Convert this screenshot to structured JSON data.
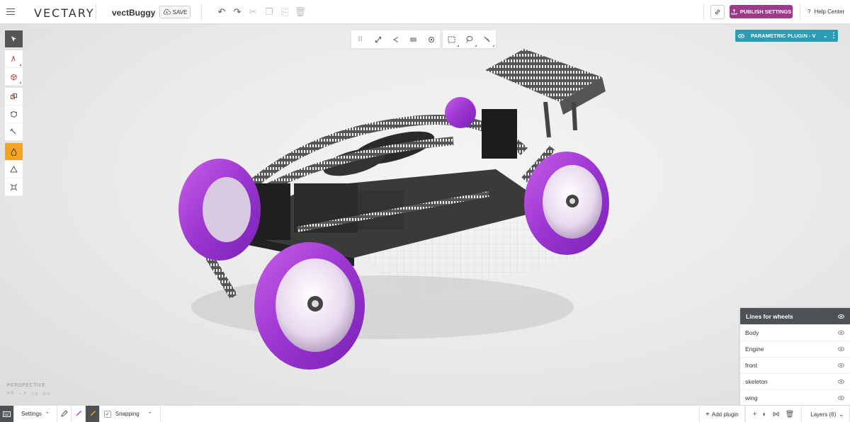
{
  "app": {
    "logo": "VECTARY",
    "project_name": "vectBuggy"
  },
  "toolbar": {
    "save_label": "SAVE"
  },
  "publish": {
    "label": "PUBLISH SETTINGS",
    "color": "#9e3a8a"
  },
  "help": {
    "label": "Help Center",
    "icon": "?"
  },
  "plugin": {
    "label": "PARAMETRIC PLUGIN - V",
    "color": "#2c9bb3"
  },
  "viewport": {
    "camera_label": "PERSPECTIVE",
    "stats": [
      "8",
      "4",
      "0",
      "0"
    ]
  },
  "layers_panel": {
    "selected": "Lines for wheels",
    "items": [
      "Body",
      "Engine",
      "front",
      "skeleton",
      "wing"
    ]
  },
  "bottom": {
    "settings_label": "Settings",
    "snapping_label": "Snapping",
    "snapping_checked": "✓",
    "add_plugin_label": "Add plugin",
    "layers_label": "Layers (6)"
  },
  "colors": {
    "accent_orange": "#f5a21e",
    "tire_purple": "#a23fd6",
    "panel_dark": "#4d5257"
  }
}
